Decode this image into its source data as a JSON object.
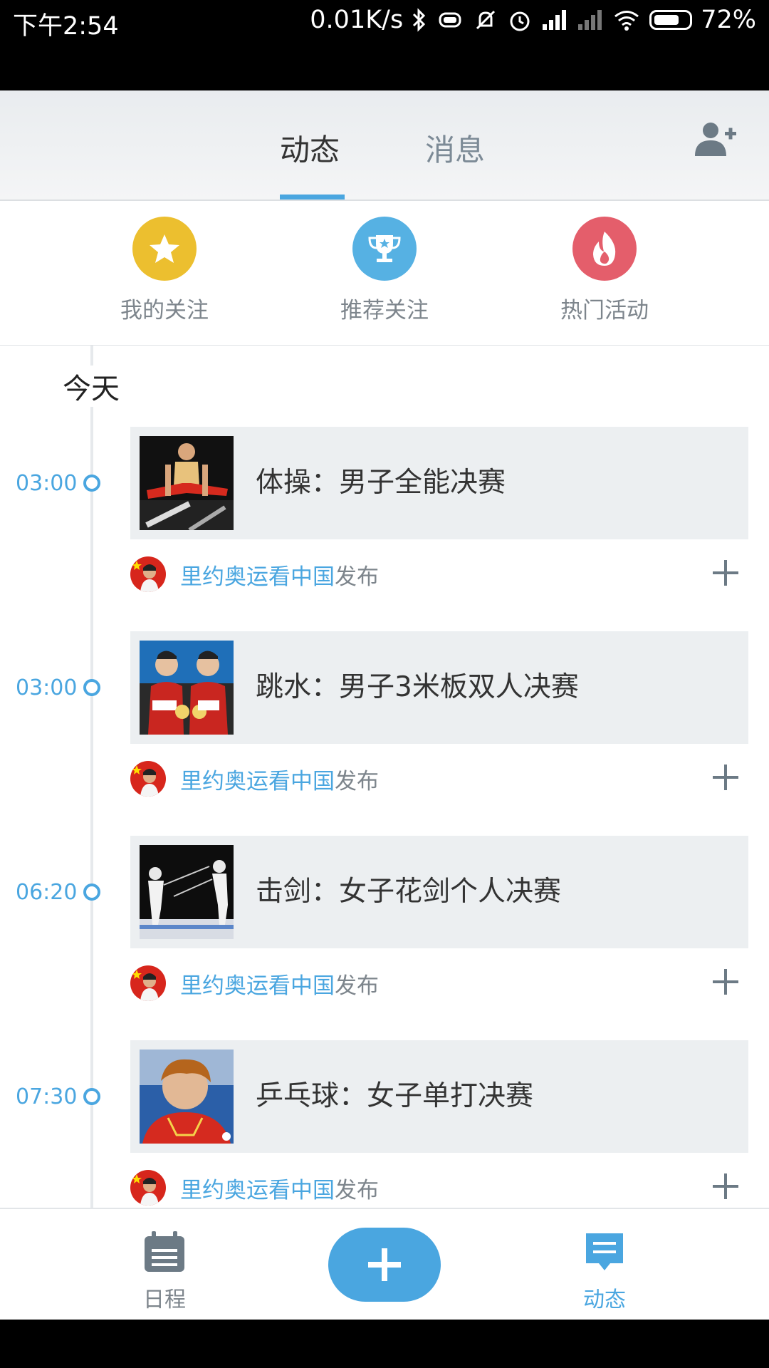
{
  "status_bar": {
    "time": "下午2:54",
    "net_speed": "0.01K/s",
    "battery": "72%"
  },
  "header": {
    "tabs": [
      {
        "label": "动态",
        "active": true
      },
      {
        "label": "消息",
        "active": false
      }
    ],
    "add_user_icon": "add-user-icon",
    "accent": "#4aa6e0"
  },
  "quick_actions": [
    {
      "label": "我的关注",
      "icon": "star-icon",
      "color": "#ecbf2f"
    },
    {
      "label": "推荐关注",
      "icon": "trophy-icon",
      "color": "#56b1e3"
    },
    {
      "label": "热门活动",
      "icon": "flame-icon",
      "color": "#e45e6b"
    }
  ],
  "feed": {
    "section_label": "今天",
    "items": [
      {
        "time": "03:00",
        "title": "体操：男子全能决赛",
        "publisher": "里约奥运看中国",
        "publish_suffix": "发布"
      },
      {
        "time": "03:00",
        "title": "跳水：男子3米板双人决赛",
        "publisher": "里约奥运看中国",
        "publish_suffix": "发布"
      },
      {
        "time": "06:20",
        "title": "击剑：女子花剑个人决赛",
        "publisher": "里约奥运看中国",
        "publish_suffix": "发布"
      },
      {
        "time": "07:30",
        "title": "乒乓球：女子单打决赛",
        "publisher": "里约奥运看中国",
        "publish_suffix": "发布"
      }
    ]
  },
  "bottom_nav": {
    "schedule_label": "日程",
    "feed_label": "动态",
    "fab_icon": "plus-icon"
  }
}
